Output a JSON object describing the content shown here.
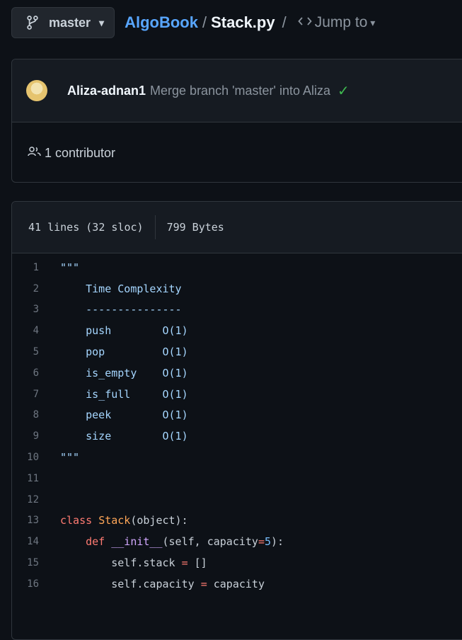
{
  "branch": {
    "label": "master",
    "icon": "git-branch-icon",
    "caret": "▾"
  },
  "breadcrumb": {
    "repo": "AlgoBook",
    "separator": "/",
    "file": "Stack.py",
    "separator2": "/",
    "jump_label": "Jump to",
    "jump_caret": "▾"
  },
  "commit": {
    "author": "Aliza-adnan1",
    "message": "Merge branch 'master' into Aliza",
    "status_icon": "check-icon",
    "status_glyph": "✓"
  },
  "contributors": {
    "label": "1 contributor",
    "icon": "people-icon"
  },
  "file": {
    "lines_info": "41 lines (32 sloc)",
    "size": "799 Bytes"
  },
  "colors": {
    "background": "#0d1117",
    "link": "#58a6ff",
    "success": "#3fb950",
    "border": "#30363d"
  },
  "code_lines": [
    {
      "n": "1",
      "t": [
        {
          "c": "str",
          "v": "\"\"\""
        }
      ]
    },
    {
      "n": "2",
      "t": [
        {
          "c": "str",
          "v": "    Time Complexity"
        }
      ]
    },
    {
      "n": "3",
      "t": [
        {
          "c": "str",
          "v": "    ---------------"
        }
      ]
    },
    {
      "n": "4",
      "t": [
        {
          "c": "str",
          "v": "    push        O(1)"
        }
      ]
    },
    {
      "n": "5",
      "t": [
        {
          "c": "str",
          "v": "    pop         O(1)"
        }
      ]
    },
    {
      "n": "6",
      "t": [
        {
          "c": "str",
          "v": "    is_empty    O(1)"
        }
      ]
    },
    {
      "n": "7",
      "t": [
        {
          "c": "str",
          "v": "    is_full     O(1)"
        }
      ]
    },
    {
      "n": "8",
      "t": [
        {
          "c": "str",
          "v": "    peek        O(1)"
        }
      ]
    },
    {
      "n": "9",
      "t": [
        {
          "c": "str",
          "v": "    size        O(1)"
        }
      ]
    },
    {
      "n": "10",
      "t": [
        {
          "c": "str",
          "v": "\"\"\""
        }
      ]
    },
    {
      "n": "11",
      "t": []
    },
    {
      "n": "12",
      "t": []
    },
    {
      "n": "13",
      "t": [
        {
          "c": "kw",
          "v": "class"
        },
        {
          "c": "",
          "v": " "
        },
        {
          "c": "cls",
          "v": "Stack"
        },
        {
          "c": "",
          "v": "(object):"
        }
      ]
    },
    {
      "n": "14",
      "t": [
        {
          "c": "",
          "v": "    "
        },
        {
          "c": "kw",
          "v": "def"
        },
        {
          "c": "",
          "v": " "
        },
        {
          "c": "fn",
          "v": "__init__"
        },
        {
          "c": "",
          "v": "(self, capacity"
        },
        {
          "c": "op",
          "v": "="
        },
        {
          "c": "num",
          "v": "5"
        },
        {
          "c": "",
          "v": "):"
        }
      ]
    },
    {
      "n": "15",
      "t": [
        {
          "c": "",
          "v": "        self.stack "
        },
        {
          "c": "op",
          "v": "="
        },
        {
          "c": "",
          "v": " []"
        }
      ]
    },
    {
      "n": "16",
      "t": [
        {
          "c": "",
          "v": "        self.capacity "
        },
        {
          "c": "op",
          "v": "="
        },
        {
          "c": "",
          "v": " capacity"
        }
      ]
    }
  ]
}
